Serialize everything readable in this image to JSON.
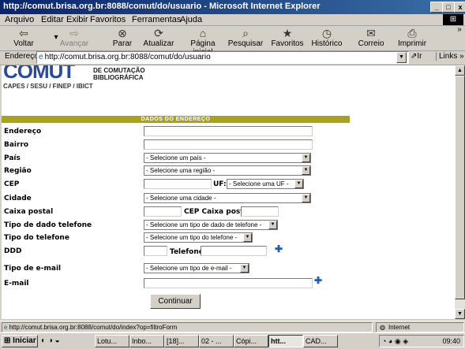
{
  "window": {
    "title": "http://comut.brisa.org.br:8088/comut/do/usuario - Microsoft Internet Explorer",
    "controls": [
      "_",
      "□",
      "x"
    ]
  },
  "menu": {
    "items": [
      "Arquivo",
      "Editar",
      "Exibir",
      "Favoritos",
      "Ferramentas",
      "Ajuda"
    ]
  },
  "toolbar": {
    "back": "Voltar",
    "forward": "Avançar",
    "stop": "Parar",
    "refresh": "Atualizar",
    "home": "Página inicial",
    "search": "Pesquisar",
    "favorites": "Favoritos",
    "history": "Histórico",
    "mail": "Correio",
    "print": "Imprimir",
    "chevron": "»"
  },
  "address": {
    "label": "Endereço",
    "url": "http://comut.brisa.org.br:8088/comut/do/usuario",
    "go": "Ir",
    "links": "Links »"
  },
  "page": {
    "logo_text": "COMUT",
    "logo_sub1": "DE COMUTAÇÃO",
    "logo_sub2": "BIBLIOGRÁFICA",
    "tagline": "CAPES / SESU / FINEP / IBICT",
    "section_title": "DADOS DO ENDEREÇO",
    "fields": {
      "endereco": "Endereço",
      "bairro": "Bairro",
      "pais": "País",
      "regiao": "Região",
      "cep": "CEP",
      "uf": "UF:",
      "cidade": "Cidade",
      "caixa_postal": "Caixa postal",
      "cep_caixa_postal": "CEP Caixa postal",
      "tipo_dado_telefone": "Tipo de dado telefone",
      "tipo_telefone": "Tipo do telefone",
      "ddd": "DDD",
      "telefone": "Telefone",
      "tipo_email": "Tipo de e-mail",
      "email": "E-mail"
    },
    "selects": {
      "pais": "- Selecione um país -",
      "regiao": "- Selecione uma região -",
      "uf": "- Selecione uma UF -",
      "cidade": "- Selecione uma cidade -",
      "tipo_dado_telefone": "- Selecione um tipo de dado de telefone -",
      "tipo_telefone": "- Selecione um tipo do telefone -",
      "tipo_email": "- Selecione um tipo de e-mail -"
    },
    "continue_button": "Continuar"
  },
  "status": {
    "text": "http://comut.brisa.org.br:8088/comut/do/index?op=filtroForm",
    "zone": "Internet"
  },
  "taskbar": {
    "start": "Iniciar",
    "tasks": [
      "Lotu...",
      "Inbo...",
      "[18]...",
      "02 - ...",
      "Cópi...",
      "htt...",
      "CAD..."
    ],
    "clock": "09:40"
  }
}
